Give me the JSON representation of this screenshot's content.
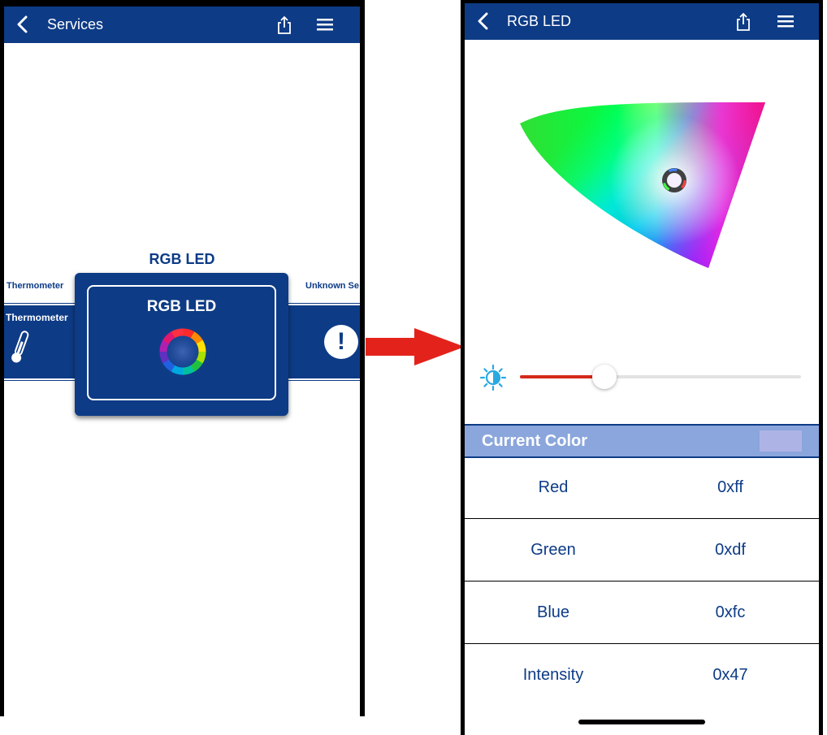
{
  "left_screen": {
    "nav": {
      "title": "Services"
    },
    "carousel": {
      "selected_title": "RGB LED",
      "left_label": "Thermometer",
      "left_card_name": "Thermometer",
      "right_label": "Unknown Se",
      "center_card_name": "RGB LED",
      "right_card_glyph": "!"
    }
  },
  "right_screen": {
    "nav": {
      "title": "RGB LED"
    },
    "brightness": {
      "level": 0.3
    },
    "current_color": {
      "label": "Current Color",
      "swatch_color": "#aeb3e6"
    },
    "rows": [
      {
        "label": "Red",
        "value": "0xff"
      },
      {
        "label": "Green",
        "value": "0xdf"
      },
      {
        "label": "Blue",
        "value": "0xfc"
      },
      {
        "label": "Intensity",
        "value": "0x47"
      }
    ]
  },
  "icons": {
    "back": "chevron-left-icon",
    "share": "share-icon",
    "menu": "hamburger-menu-icon",
    "thermometer": "thermometer-icon",
    "alert": "alert-icon",
    "color_ring": "color-ring-icon",
    "brightness": "brightness-icon"
  },
  "colors": {
    "nav_blue": "#0d3b86",
    "header_blue": "#8aa6dc",
    "slider_red": "#d52a1a",
    "arrow_red": "#e3231b"
  }
}
